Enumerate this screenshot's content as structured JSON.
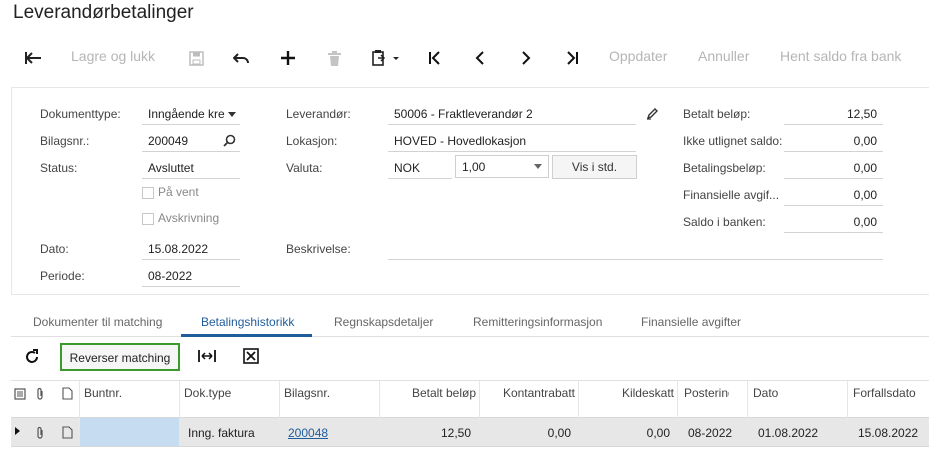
{
  "page": {
    "title": "Leverandørbetalinger"
  },
  "toolbar": {
    "icons": [
      "back-arrow-icon",
      "save-icon",
      "undo-icon",
      "add-icon",
      "delete-icon",
      "clipboard-icon",
      "first-record-icon",
      "previous-icon",
      "next-icon",
      "last-record-icon"
    ],
    "save_close_label": "Lagre og lukk",
    "refresh_label": "Oppdater",
    "cancel_label": "Annuller",
    "fetch_balance_label": "Hent saldo fra bank"
  },
  "form": {
    "doc_type": {
      "label": "Dokumenttype:",
      "value": "Inngående kre"
    },
    "ref_nbr": {
      "label": "Bilagsnr.:",
      "value": "200049"
    },
    "status": {
      "label": "Status:",
      "value": "Avsluttet"
    },
    "hold": {
      "label": "På vent",
      "checked": false
    },
    "writeoff": {
      "label": "Avskrivning",
      "checked": false
    },
    "date": {
      "label": "Dato:",
      "value": "15.08.2022"
    },
    "period": {
      "label": "Periode:",
      "value": "08-2022"
    },
    "vendor": {
      "label": "Leverandør:",
      "value": "50006 - Fraktleverandør 2"
    },
    "location": {
      "label": "Lokasjon:",
      "value": "HOVED - Hovedlokasjon"
    },
    "currency": {
      "label": "Valuta:",
      "code": "NOK",
      "rate": "1,00",
      "view_base_label": "Vis i std."
    },
    "description": {
      "label": "Beskrivelse:",
      "value": ""
    },
    "paid_amount": {
      "label": "Betalt beløp:",
      "value": "12,50"
    },
    "unapplied_balance": {
      "label": "Ikke utlignet saldo:",
      "value": "0,00"
    },
    "payment_amount": {
      "label": "Betalingsbeløp:",
      "value": "0,00"
    },
    "finance_charges": {
      "label": "Finansielle avgif...",
      "value": "0,00"
    },
    "bank_balance": {
      "label": "Saldo i banken:",
      "value": "0,00"
    }
  },
  "tabs": [
    "Dokumenter til matching",
    "Betalingshistorikk",
    "Regnskapsdetaljer",
    "Remitteringsinformasjon",
    "Finansielle avgifter"
  ],
  "active_tab": "Betalingshistorikk",
  "grid_toolbar": {
    "reverse_label": "Reverser matching"
  },
  "grid": {
    "columns": [
      "Buntnr.",
      "Dok.type",
      "Bilagsnr.",
      "Betalt beløp",
      "Kontantrabatt",
      "Kildeskatt",
      "Posteringsperiode",
      "Dato",
      "Forfallsdato"
    ],
    "rows": [
      {
        "batch": "",
        "doc_type": "Inng. faktura",
        "ref_nbr": "200048",
        "paid": "12,50",
        "cash_discount": "0,00",
        "withholding": "0,00",
        "period": "08-2022",
        "date": "01.08.2022",
        "due_date": "15.08.2022"
      }
    ]
  },
  "colors": {
    "accent": "#1f5c9c",
    "highlight_border": "#3a9a2c",
    "selected_cell": "#c6dcf1"
  }
}
